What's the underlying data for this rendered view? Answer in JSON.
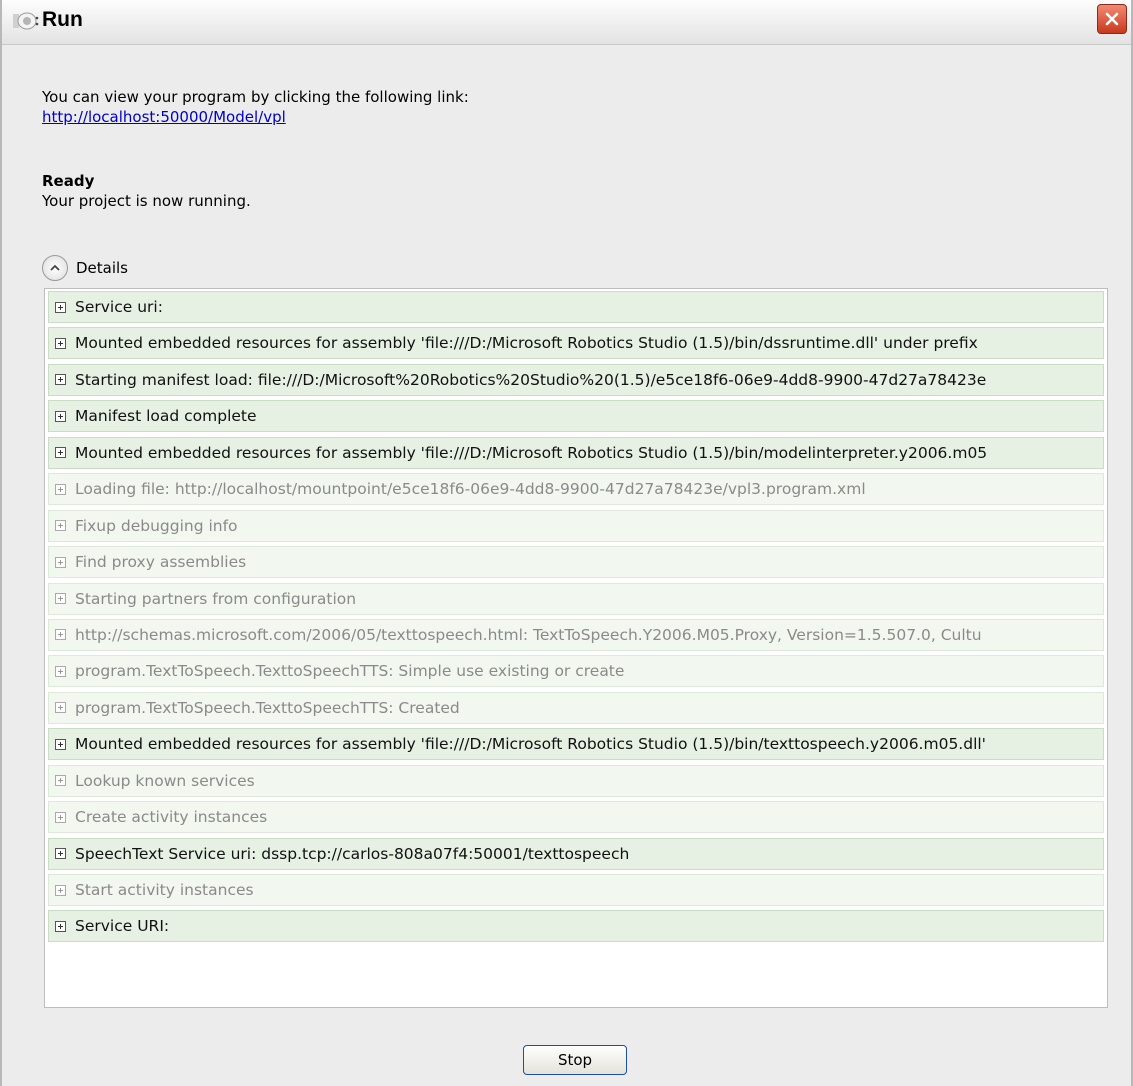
{
  "window": {
    "title": "Run",
    "close_icon": "close-icon"
  },
  "main": {
    "link_intro": "You can view your program by clicking the following link:",
    "link_url": "http://localhost:50000/Model/vpl",
    "status_title": "Ready",
    "status_message": "Your project is now running.",
    "details_label": "Details"
  },
  "log": [
    {
      "text": "Service uri:",
      "dim": false
    },
    {
      "text": "Mounted embedded resources for assembly 'file:///D:/Microsoft Robotics Studio (1.5)/bin/dssruntime.dll' under prefix",
      "dim": false
    },
    {
      "text": "Starting manifest load: file:///D:/Microsoft%20Robotics%20Studio%20(1.5)/e5ce18f6-06e9-4dd8-9900-47d27a78423e",
      "dim": false
    },
    {
      "text": "Manifest load complete",
      "dim": false
    },
    {
      "text": "Mounted embedded resources for assembly 'file:///D:/Microsoft Robotics Studio (1.5)/bin/modelinterpreter.y2006.m05",
      "dim": false
    },
    {
      "text": "Loading file: http://localhost/mountpoint/e5ce18f6-06e9-4dd8-9900-47d27a78423e/vpl3.program.xml",
      "dim": true
    },
    {
      "text": "Fixup debugging info",
      "dim": true
    },
    {
      "text": "Find proxy assemblies",
      "dim": true
    },
    {
      "text": "Starting partners from configuration",
      "dim": true
    },
    {
      "text": "http://schemas.microsoft.com/2006/05/texttospeech.html: TextToSpeech.Y2006.M05.Proxy, Version=1.5.507.0, Cultu",
      "dim": true
    },
    {
      "text": "program.TextToSpeech.TexttoSpeechTTS: Simple use existing or create",
      "dim": true
    },
    {
      "text": "program.TextToSpeech.TexttoSpeechTTS: Created",
      "dim": true
    },
    {
      "text": "Mounted embedded resources for assembly 'file:///D:/Microsoft Robotics Studio (1.5)/bin/texttospeech.y2006.m05.dll'",
      "dim": false
    },
    {
      "text": "Lookup known services",
      "dim": true
    },
    {
      "text": "Create activity instances",
      "dim": true
    },
    {
      "text": "SpeechText Service uri: dssp.tcp://carlos-808a07f4:50001/texttospeech",
      "dim": false
    },
    {
      "text": "Start activity instances",
      "dim": true
    },
    {
      "text": "Service URI:",
      "dim": false
    }
  ],
  "footer": {
    "stop_label": "Stop"
  }
}
